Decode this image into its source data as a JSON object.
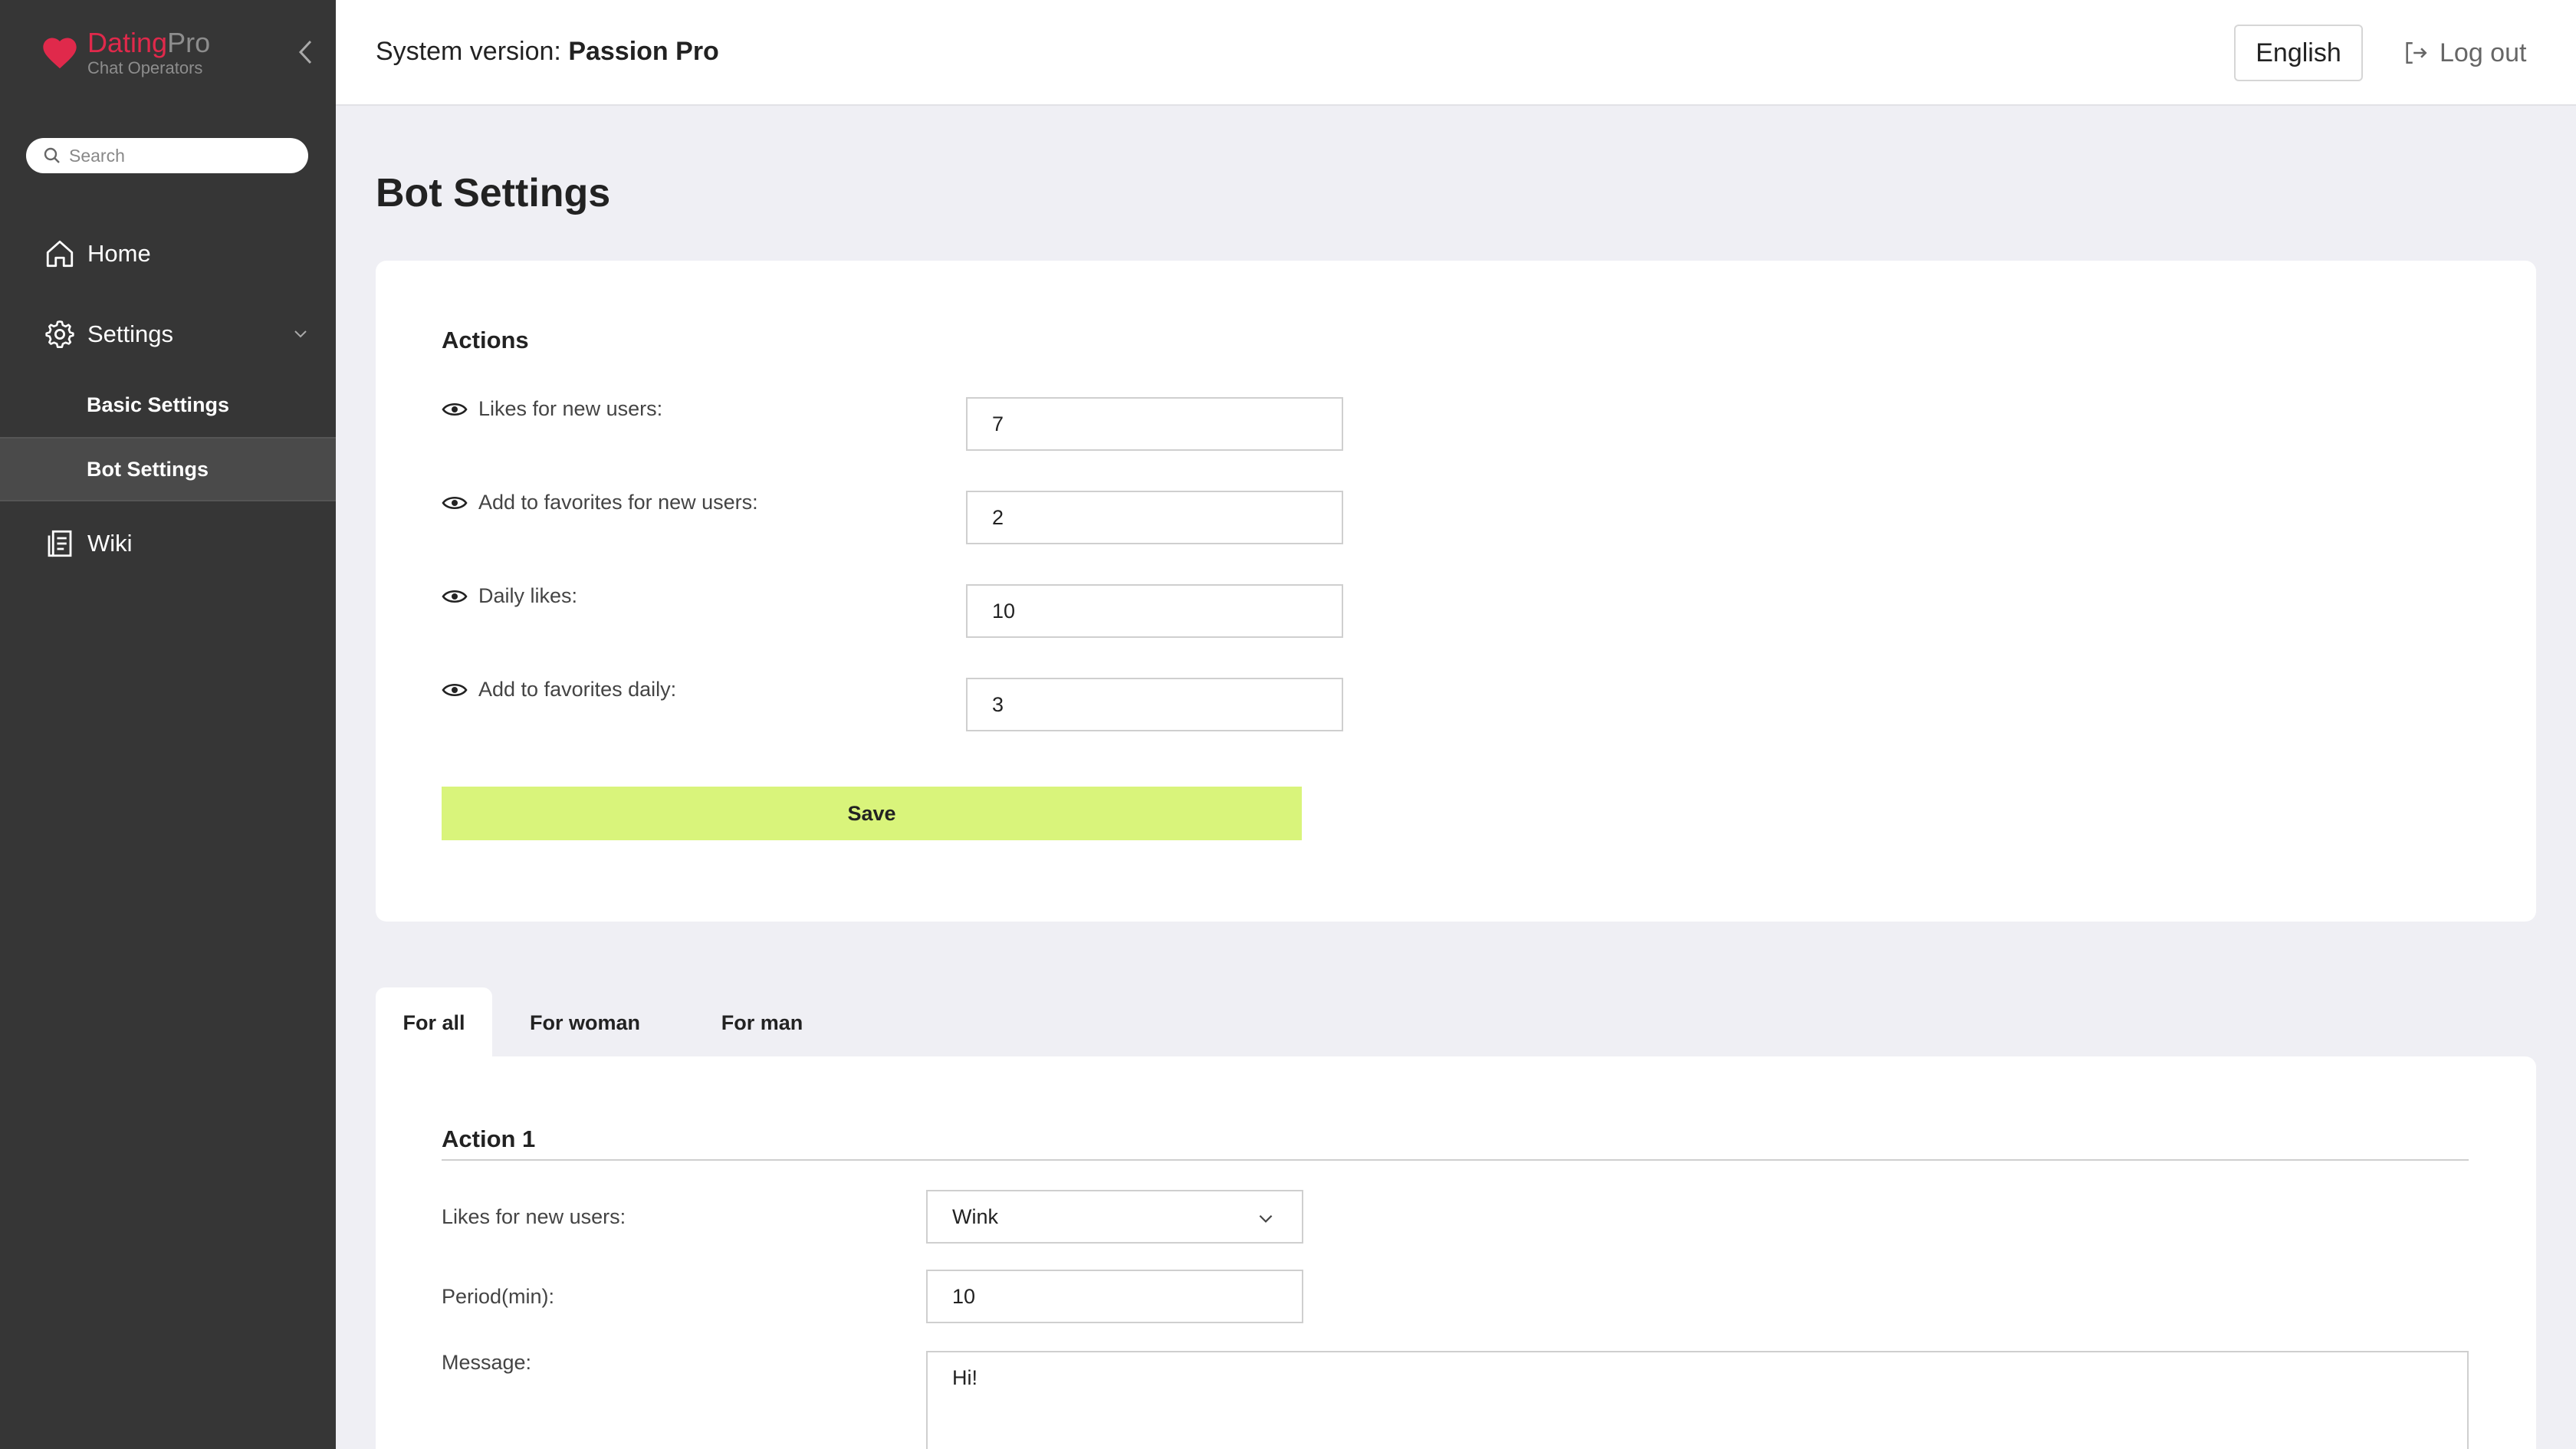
{
  "brand": {
    "name_part1": "Dating",
    "name_part2": "Pro",
    "subtitle": "Chat Operators"
  },
  "search": {
    "placeholder": "Search"
  },
  "nav": {
    "home": "Home",
    "settings": "Settings",
    "basic_settings": "Basic Settings",
    "bot_settings": "Bot Settings",
    "wiki": "Wiki"
  },
  "topbar": {
    "system_version_label": "System version:",
    "system_version_value": "Passion Pro",
    "language": "English",
    "logout": "Log out"
  },
  "page_title": "Bot Settings",
  "actions": {
    "title": "Actions",
    "rows": [
      {
        "label": "Likes for new users:",
        "value": "7"
      },
      {
        "label": "Add to favorites for new users:",
        "value": "2"
      },
      {
        "label": "Daily likes:",
        "value": "10"
      },
      {
        "label": "Add to favorites daily:",
        "value": "3"
      }
    ],
    "save_label": "Save"
  },
  "tabs": {
    "for_all": "For all",
    "for_woman": "For woman",
    "for_man": "For man"
  },
  "action1": {
    "title": "Action 1",
    "likes_label": "Likes for new users:",
    "likes_selected": "Wink",
    "period_label": "Period(min):",
    "period_value": "10",
    "message_label": "Message:",
    "message_value": "Hi!"
  },
  "colors": {
    "sidebar_bg": "#363636",
    "brand_red": "#e0294b",
    "save_button": "#d9f47b",
    "page_bg": "#efeff4"
  }
}
